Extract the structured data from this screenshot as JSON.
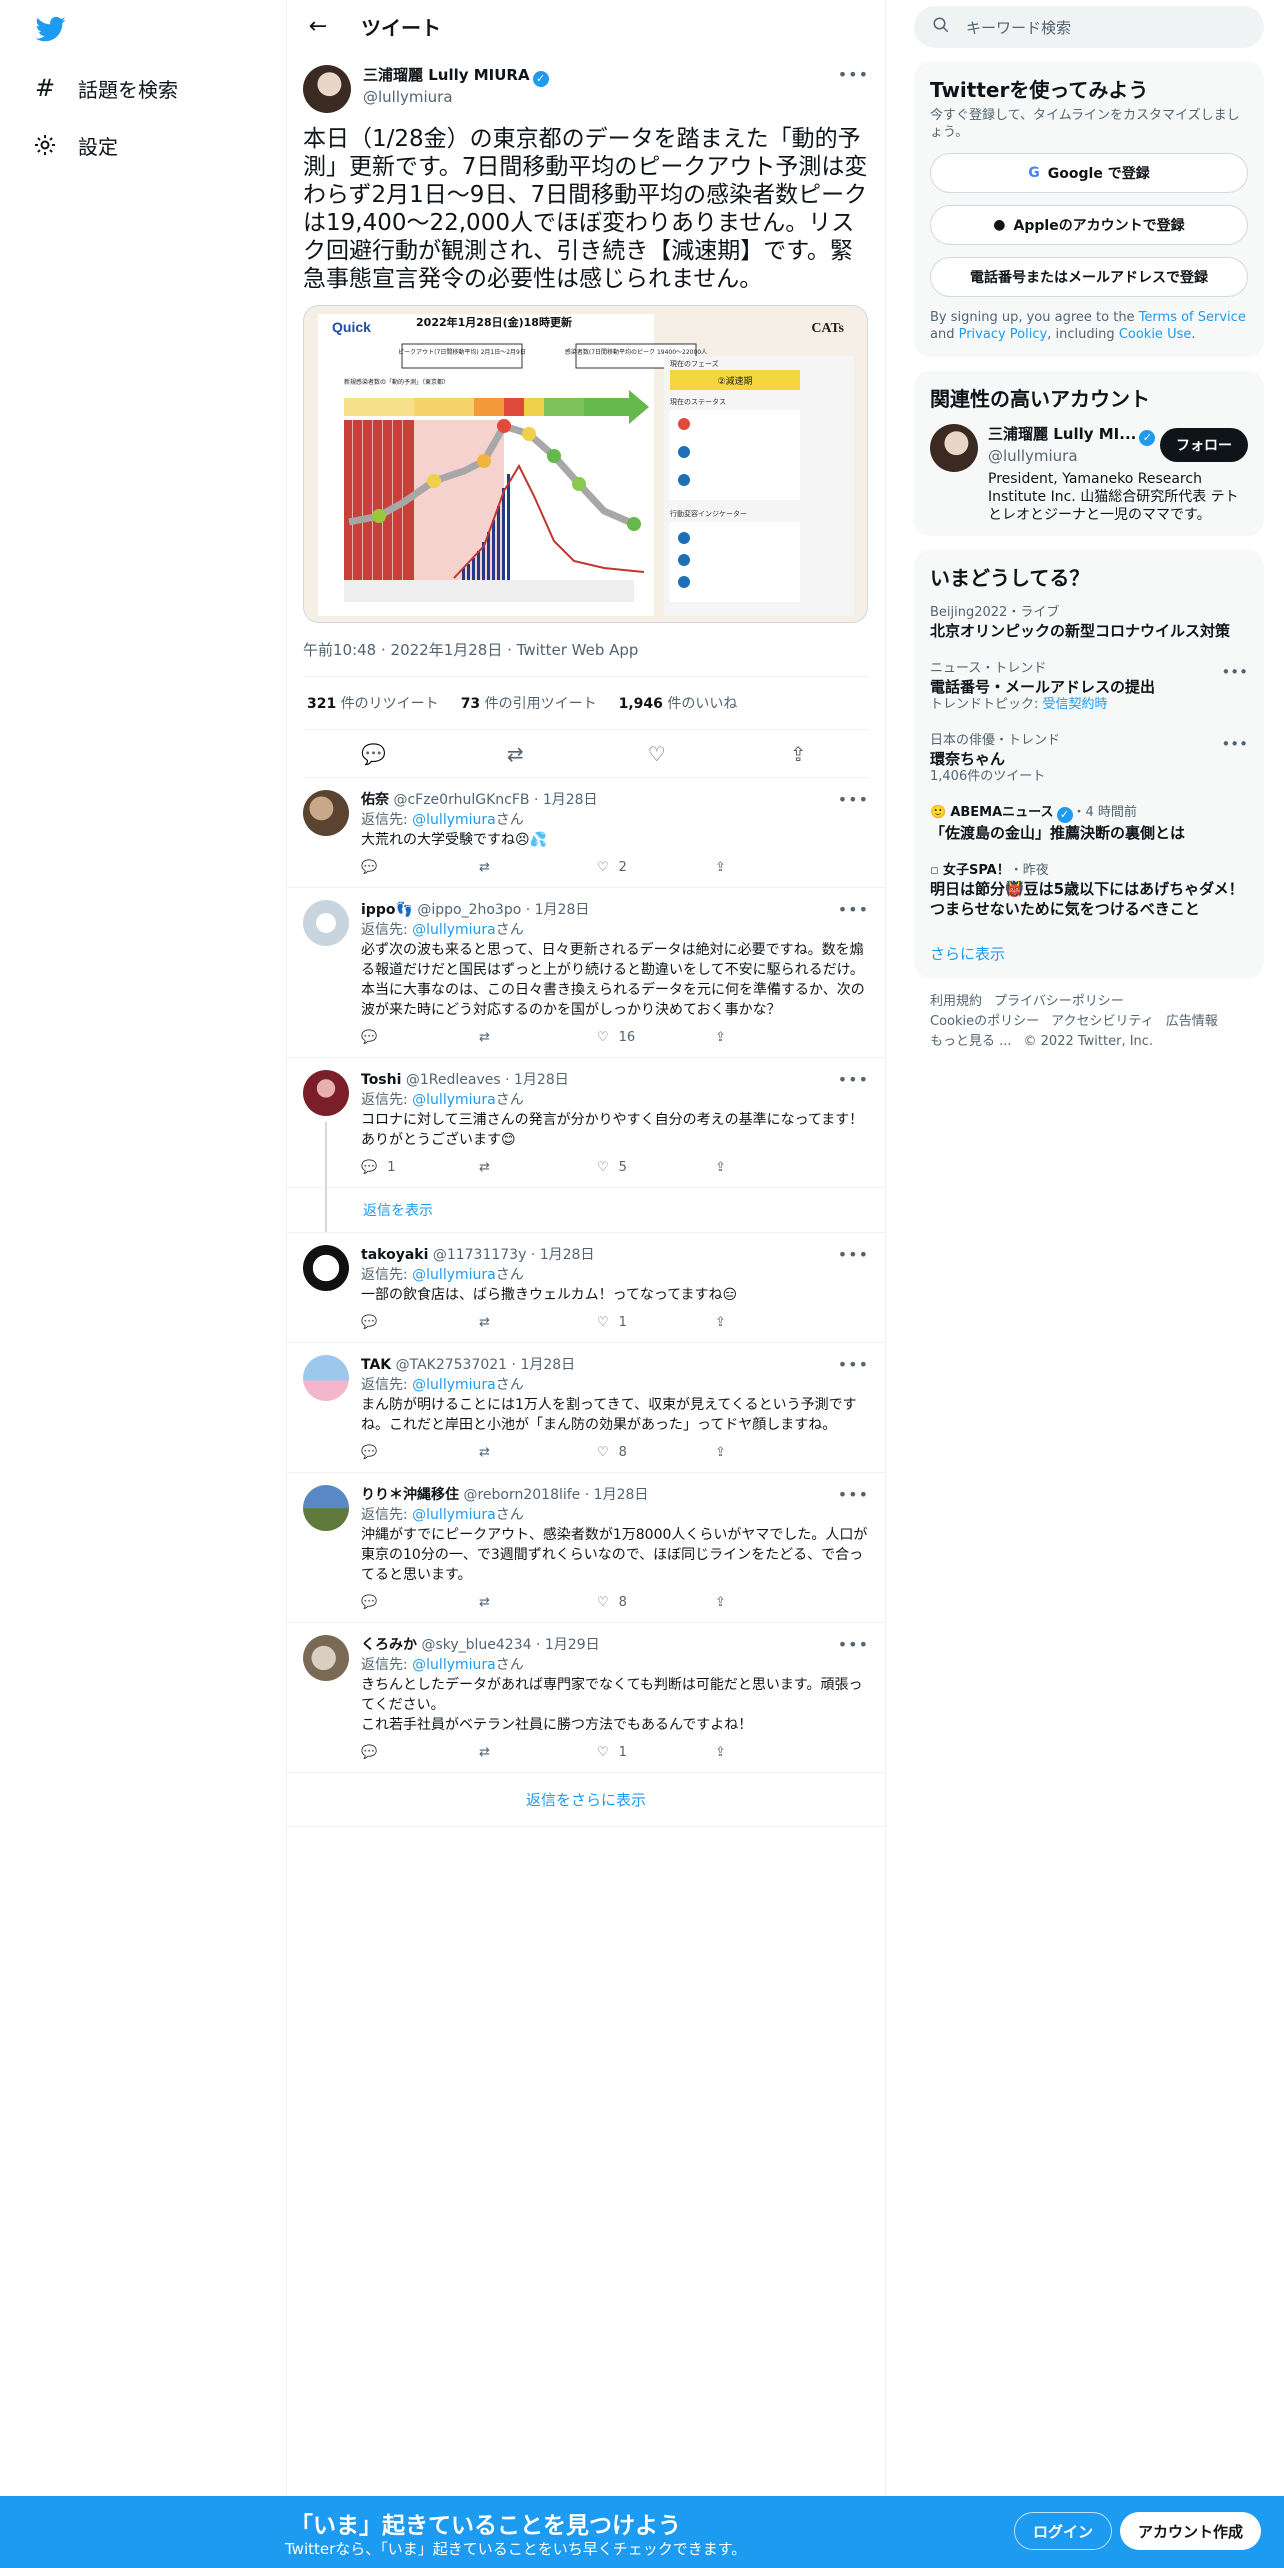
{
  "nav": {
    "explore_label": "話題を検索",
    "settings_label": "設定"
  },
  "header": {
    "title": "ツイート"
  },
  "tweet": {
    "display_name": "三浦瑠麗 Lully MIURA",
    "handle": "@lullymiura",
    "text": "本日（1/28金）の東京都のデータを踏まえた「動的予測」更新です。7日間移動平均のピークアウト予測は変わらず2月1日～9日、7日間移動平均の感染者数ピークは19,400～22,000人でほぼ変わりありません。リスク回避行動が観測され、引き続き【減速期】です。緊急事態宣言発令の必要性は感じられません。",
    "image": {
      "brand_left": "Quick",
      "headline": "2022年1月28日(金)18時更新",
      "brand_right": "CATs",
      "peak_box_1": "ピークアウト(7日間移動平均)\n2月1日～2月9日",
      "peak_box_2": "感染者数(7日間移動平均のピーク\n19400～22000人",
      "phase_label": "現在のフェーズ",
      "phase_value": "②減速期",
      "status_label": "現在のステータス",
      "indicator_label": "行動変容インジケーター",
      "chart_title": "新規感染者数の「動的予測」（東京都）"
    },
    "timestamp": "午前10:48 · 2022年1月28日 · Twitter Web App",
    "retweets": "321",
    "retweets_label": "件のリツイート",
    "quotes": "73",
    "quotes_label": "件の引用ツイート",
    "likes": "1,946",
    "likes_label": "件のいいね"
  },
  "replies": [
    {
      "name": "佑奈",
      "handle": "@cFze0rhulGKncFB",
      "date": "· 1月28日",
      "reply_to_prefix": "返信先: ",
      "reply_to": "@lullymiura",
      "reply_to_suffix": "さん",
      "text": "大荒れの大学受験ですね😣💦",
      "replies": "",
      "retweets": "",
      "likes": "2"
    },
    {
      "name": "ippo👣",
      "handle": "@ippo_2ho3po",
      "date": "· 1月28日",
      "reply_to_prefix": "返信先: ",
      "reply_to": "@lullymiura",
      "reply_to_suffix": "さん",
      "text": "必ず次の波も来ると思って、日々更新されるデータは絶対に必要ですね。数を煽る報道だけだと国民はずっと上がり続けると勘違いをして不安に駆られるだけ。本当に大事なのは、この日々書き換えられるデータを元に何を準備するか、次の波が来た時にどう対応するのかを国がしっかり決めておく事かな？",
      "replies": "",
      "retweets": "",
      "likes": "16"
    },
    {
      "name": "Toshi",
      "handle": "@1Redleaves",
      "date": "· 1月28日",
      "reply_to_prefix": "返信先: ",
      "reply_to": "@lullymiura",
      "reply_to_suffix": "さん",
      "text": "コロナに対して三浦さんの発言が分かりやすく自分の考えの基準になってます！ありがとうございます😊",
      "replies": "1",
      "retweets": "",
      "likes": "5"
    },
    {
      "name": "takoyaki",
      "handle": "@11731173y",
      "date": "· 1月28日",
      "reply_to_prefix": "返信先: ",
      "reply_to": "@lullymiura",
      "reply_to_suffix": "さん",
      "text": "一部の飲食店は、ばら撒きウェルカム！ってなってますね😑",
      "replies": "",
      "retweets": "",
      "likes": "1"
    },
    {
      "name": "TAK",
      "handle": "@TAK27537021",
      "date": "· 1月28日",
      "reply_to_prefix": "返信先: ",
      "reply_to": "@lullymiura",
      "reply_to_suffix": "さん",
      "text": "まん防が明けることには1万人を割ってきて、収束が見えてくるという予測ですね。これだと岸田と小池が「まん防の効果があった」ってドヤ顔しますね。",
      "replies": "",
      "retweets": "",
      "likes": "8"
    },
    {
      "name": "りり＊沖縄移住",
      "handle": "@reborn2018life",
      "date": "· 1月28日",
      "reply_to_prefix": "返信先: ",
      "reply_to": "@lullymiura",
      "reply_to_suffix": "さん",
      "text": "沖縄がすでにピークアウト、感染者数が1万8000人くらいがヤマでした。人口が東京の10分の一、で3週間ずれくらいなので、ほぼ同じラインをたどる、で合ってると思います。",
      "replies": "",
      "retweets": "",
      "likes": "8"
    },
    {
      "name": "くろみか",
      "handle": "@sky_blue4234",
      "date": "· 1月29日",
      "reply_to_prefix": "返信先: ",
      "reply_to": "@lullymiura",
      "reply_to_suffix": "さん",
      "text": "きちんとしたデータがあれば専門家でなくても判断は可能だと思います。頑張ってください。\nこれ若手社員がベテラン社員に勝つ方法でもあるんですよね！",
      "replies": "",
      "retweets": "",
      "likes": "1"
    }
  ],
  "show_replies_label": "返信を表示",
  "show_more_replies_label": "返信をさらに表示",
  "right": {
    "search_placeholder": "キーワード検索",
    "signup": {
      "title": "Twitterを使ってみよう",
      "subtitle": "今すぐ登録して、タイムラインをカスタマイズしましょう。",
      "google_label": "Google で登録",
      "apple_label": "Appleのアカウントで登録",
      "phone_label": "電話番号またはメールアドレスで登録",
      "legal_prefix": "By signing up, you agree to the ",
      "terms": "Terms of Service",
      "legal_and": " and ",
      "privacy": "Privacy Policy",
      "legal_including": ", including ",
      "cookie": "Cookie Use",
      "legal_end": "."
    },
    "related": {
      "title": "関連性の高いアカウント",
      "name": "三浦瑠麗 Lully MI...",
      "handle": "@lullymiura",
      "follow_label": "フォロー",
      "bio": "President, Yamaneko Research Institute Inc. 山猫総合研究所代表 テトとレオとジーナと一児のママです。"
    },
    "trends": {
      "title": "いまどうしてる？",
      "items": [
        {
          "context": "Beijing2022・ライブ",
          "title": "北京オリンピックの新型コロナウイルス対策",
          "extra": ""
        },
        {
          "context": "ニュース・トレンド",
          "title": "電話番号・メールアドレスの提出",
          "extra_prefix": "トレンドトピック: ",
          "extra_link": "受信契約時"
        },
        {
          "context": "日本の俳優・トレンド",
          "title": "環奈ちゃん",
          "extra": "1,406件のツイート"
        },
        {
          "context_name": "ABEMAニュース",
          "context_time": "・4 時間前",
          "title": "「佐渡島の金山」推薦決断の裏側とは",
          "extra": ""
        },
        {
          "context_name": "女子SPA！",
          "context_time": "・昨夜",
          "title": "明日は節分👹豆は5歳以下にはあげちゃダメ！つまらせないために気をつけるべきこと",
          "extra": ""
        }
      ],
      "more_label": "さらに表示"
    },
    "footer": [
      "利用規約",
      "プライバシーポリシー",
      "Cookieのポリシー",
      "アクセシビリティ",
      "広告情報",
      "もっと見る ...",
      "© 2022 Twitter, Inc."
    ]
  },
  "bottom": {
    "title": "「いま」起きていることを見つけよう",
    "subtitle": "Twitterなら、「いま」起きていることをいち早くチェックできます。",
    "login_label": "ログイン",
    "signup_label": "アカウント作成"
  },
  "colors": {
    "accent": "#1d9bf0",
    "text": "#0f1419",
    "muted": "#536471"
  }
}
